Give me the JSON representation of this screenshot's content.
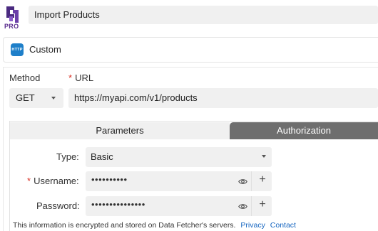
{
  "app": {
    "badge": "PRO",
    "title": "Import Products"
  },
  "source": {
    "icon_text": "HTTP",
    "label": "Custom"
  },
  "request": {
    "method_label": "Method",
    "method_value": "GET",
    "url_label": "URL",
    "url_value": "https://myapi.com/v1/products"
  },
  "tabs": [
    {
      "label": "Parameters",
      "active": false
    },
    {
      "label": "Authorization",
      "active": true
    }
  ],
  "auth": {
    "type_label": "Type:",
    "type_value": "Basic",
    "username_label": "Username:",
    "username_value": "••••••••••",
    "password_label": "Password:",
    "password_value": "•••••••••••••••"
  },
  "footer": {
    "note": "This information is encrypted and stored on Data Fetcher's servers.",
    "privacy_link": "Privacy",
    "contact_link": "Contact"
  },
  "colors": {
    "accent": "#1e7fc9",
    "active_tab": "#6e6e6e",
    "required": "#d93025",
    "link": "#1565c0",
    "logo": "#5b2d8e"
  }
}
